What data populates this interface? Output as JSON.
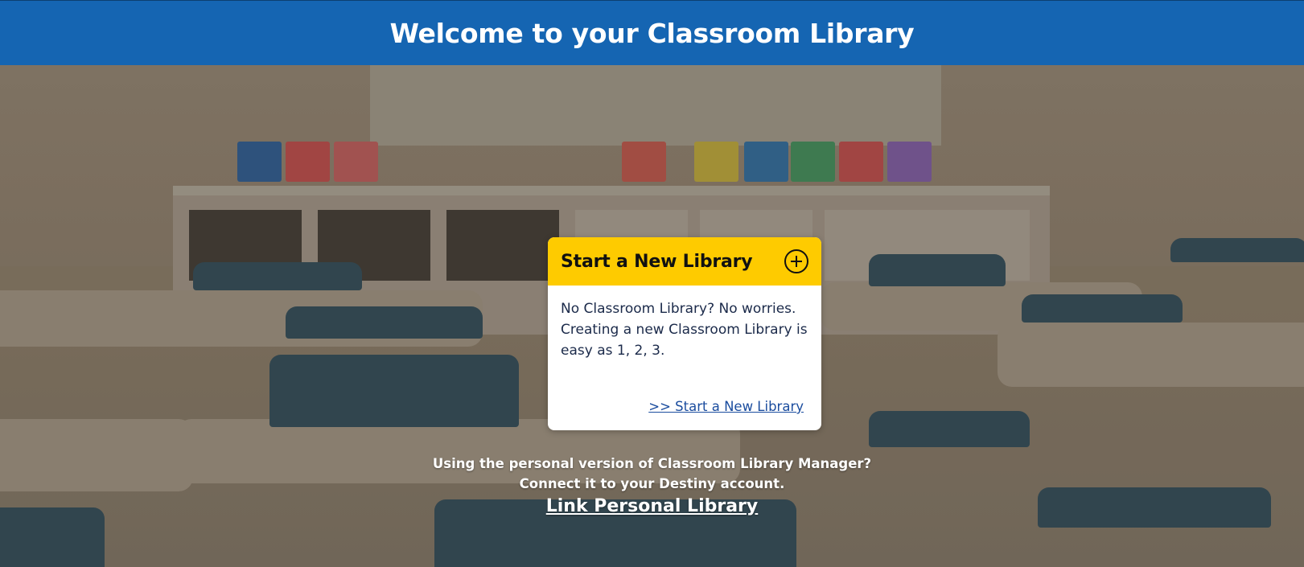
{
  "header": {
    "title": "Welcome to your Classroom Library",
    "background_color": "#1565b2"
  },
  "card": {
    "title": "Start a New Library",
    "icon": "plus-circle-icon",
    "header_color": "#fecb00",
    "body": "No Classroom Library? No worries. Creating a new Classroom Library is easy as 1, 2, 3.",
    "link": ">> Start a New Library"
  },
  "personal": {
    "line1": "Using the personal version of Classroom Library Manager?",
    "line2": "Connect it to your Destiny account.",
    "link": "Link Personal Library"
  }
}
